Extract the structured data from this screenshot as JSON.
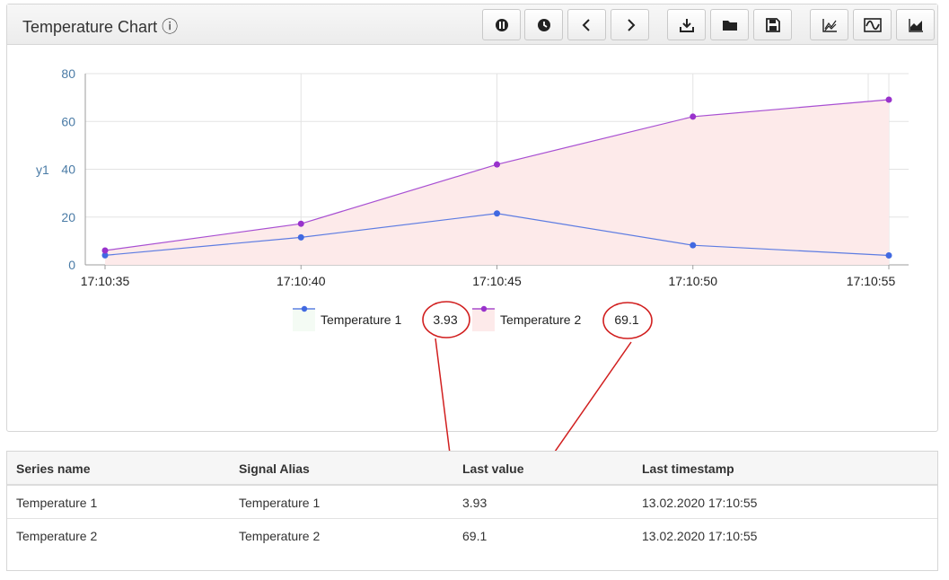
{
  "panel": {
    "title": "Temperature Chart ⓘ",
    "toolbar": [
      {
        "name": "pause-button",
        "icon": "pause-icon"
      },
      {
        "name": "history-button",
        "icon": "clock-icon"
      },
      {
        "name": "previous-button",
        "icon": "chevron-left-icon"
      },
      {
        "name": "next-button",
        "icon": "chevron-right-icon"
      },
      {
        "name": "download-button",
        "icon": "download-icon"
      },
      {
        "name": "open-folder-button",
        "icon": "folder-icon"
      },
      {
        "name": "save-button",
        "icon": "save-icon"
      },
      {
        "name": "line-chart-button",
        "icon": "line-chart-icon"
      },
      {
        "name": "wave-chart-button",
        "icon": "wave-icon"
      },
      {
        "name": "area-chart-button",
        "icon": "area-chart-icon"
      }
    ]
  },
  "chart_data": {
    "type": "line",
    "ylabel": "y1",
    "ylim": [
      0,
      80
    ],
    "yticks": [
      "0",
      "20",
      "40",
      "60",
      "80"
    ],
    "xticks": [
      "17:10:35",
      "17:10:40",
      "17:10:45",
      "17:10:50",
      "17:10:55"
    ],
    "grid": true,
    "legend_position": "bottom-center",
    "series": [
      {
        "name": "Temperature 1",
        "color": "#4169e1",
        "area": false,
        "points": [
          {
            "t": "17:10:35",
            "y": 4
          },
          {
            "t": "17:10:40",
            "y": 11.5
          },
          {
            "t": "17:10:45",
            "y": 21.5
          },
          {
            "t": "17:10:50",
            "y": 8.2
          },
          {
            "t": "17:10:55",
            "y": 3.93
          }
        ],
        "legend_value": "3.93"
      },
      {
        "name": "Temperature 2",
        "color": "#9932cc",
        "area": true,
        "area_color": "#fdeaea",
        "points": [
          {
            "t": "17:10:35",
            "y": 6
          },
          {
            "t": "17:10:40",
            "y": 17.2
          },
          {
            "t": "17:10:45",
            "y": 42
          },
          {
            "t": "17:10:50",
            "y": 62
          },
          {
            "t": "17:10:55",
            "y": 69.1
          }
        ],
        "legend_value": "69.1"
      }
    ],
    "annotation_color": "#d11f1f"
  },
  "table": {
    "headers": [
      "Series name",
      "Signal Alias",
      "Last value",
      "Last timestamp"
    ],
    "rows": [
      [
        "Temperature 1",
        "Temperature 1",
        "3.93",
        "13.02.2020 17:10:55"
      ],
      [
        "Temperature 2",
        "Temperature 2",
        "69.1",
        "13.02.2020 17:10:55"
      ]
    ]
  }
}
